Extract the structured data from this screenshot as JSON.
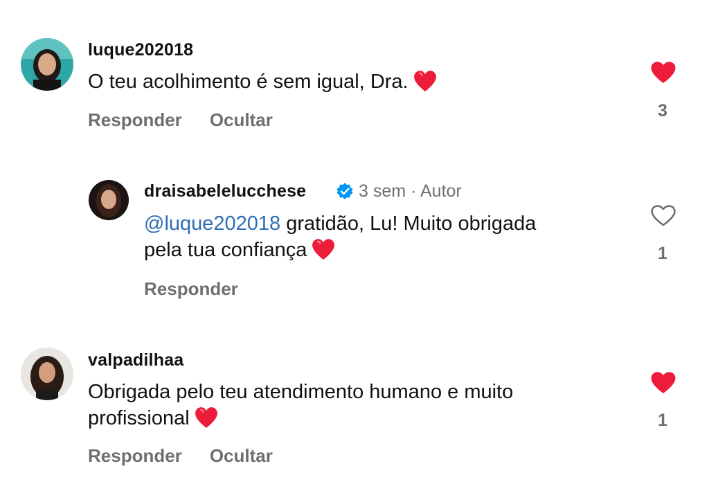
{
  "comments": [
    {
      "username": "luque202018",
      "text": "O teu acolhimento é sem igual, Dra.",
      "liked": true,
      "likes": "3",
      "actions": [
        "Responder",
        "Ocultar"
      ]
    },
    {
      "username": "draisabelelucchese",
      "verified": true,
      "time": "3 sem",
      "role": "Autor",
      "mention": "@luque202018",
      "text_line1": " gratidão, Lu! Muito obrigada",
      "text_line2": "pela tua confiança",
      "liked": false,
      "likes": "1",
      "actions": [
        "Responder"
      ]
    },
    {
      "username": "valpadilhaa",
      "text_line1": "Obrigada pelo teu atendimento humano e muito",
      "text_line2": "profissional",
      "liked": true,
      "likes": "1",
      "actions": [
        "Responder",
        "Ocultar"
      ]
    }
  ],
  "separator": " · ",
  "colors": {
    "heart_red": "#ed1c3a",
    "mention_blue": "#2d6eb5",
    "verified_blue": "#0095f6",
    "secondary_text": "#6f6f6f"
  }
}
